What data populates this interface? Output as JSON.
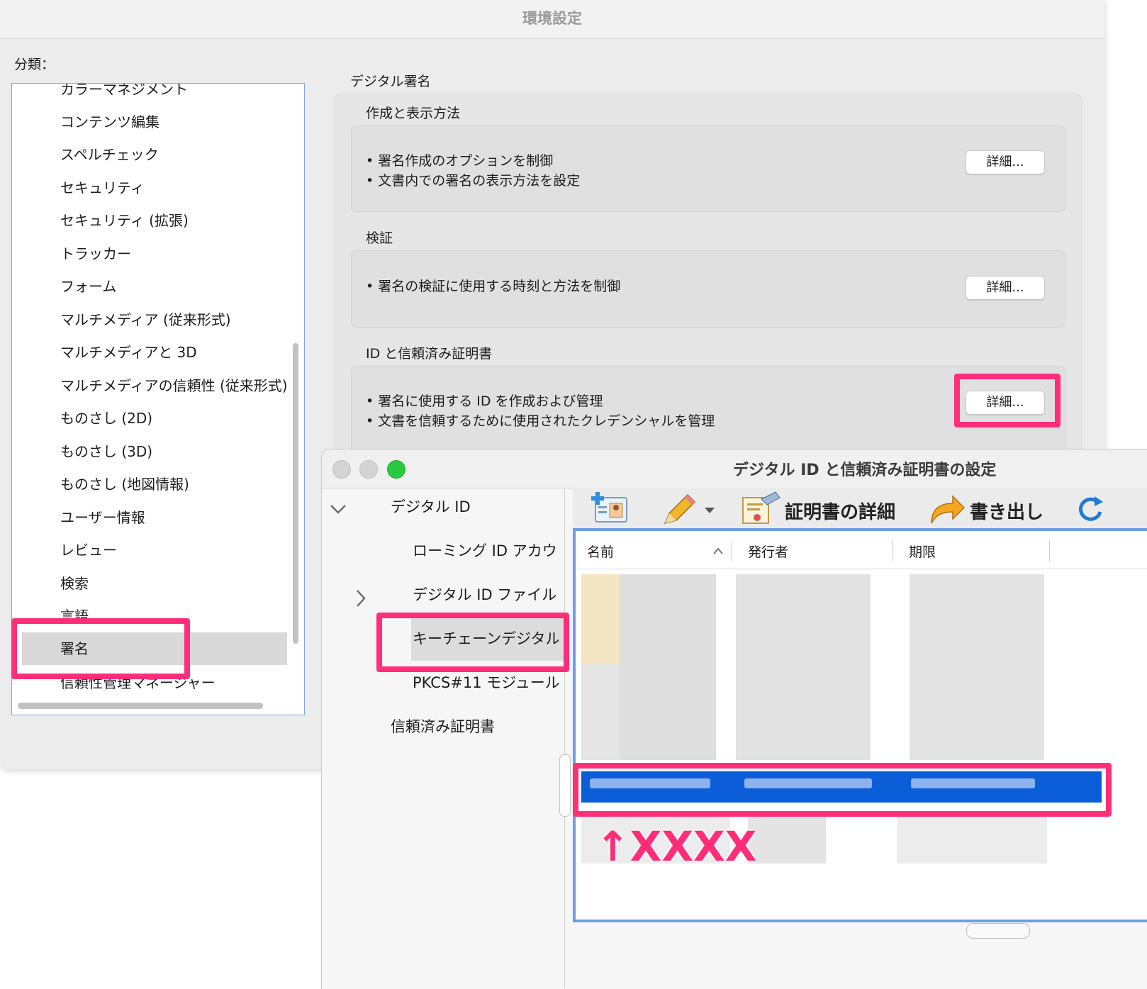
{
  "window": {
    "title": "環境設定"
  },
  "category_label": "分類：",
  "categories": [
    "カラーマネジメント",
    "コンテンツ編集",
    "スペルチェック",
    "セキュリティ",
    "セキュリティ (拡張)",
    "トラッカー",
    "フォーム",
    "マルチメディア (従来形式)",
    "マルチメディアと 3D",
    "マルチメディアの信頼性 (従来形式)",
    "ものさし (2D)",
    "ものさし (3D)",
    "ものさし (地図情報)",
    "ユーザー情報",
    "レビュー",
    "検索",
    "言語",
    "署名",
    "信頼性管理マネージャー"
  ],
  "selected_category": "署名",
  "signatures": {
    "heading": "デジタル署名",
    "sections": [
      {
        "title": "作成と表示方法",
        "bullets": [
          "• 署名作成のオプションを制御",
          "• 文書内での署名の表示方法を設定"
        ],
        "button": "詳細..."
      },
      {
        "title": "検証",
        "bullets": [
          "• 署名の検証に使用する時刻と方法を制御"
        ],
        "button": "詳細..."
      },
      {
        "title": "ID と信頼済み証明書",
        "bullets": [
          "• 署名に使用する ID を作成および管理",
          "• 文書を信頼するために使用されたクレデンシャルを管理"
        ],
        "button": "詳細..."
      }
    ]
  },
  "dialog": {
    "title": "デジタル ID と信頼済み証明書の設定",
    "tree": {
      "digital_id": "デジタル ID",
      "roaming": "ローミング ID アカウ",
      "id_file": "デジタル ID ファイル",
      "keychain": "キーチェーンデジタル",
      "pkcs": "PKCS#11 モジュール",
      "trusted": "信頼済み証明書"
    },
    "toolbar": {
      "cert_details": "証明書の詳細",
      "export": "書き出し"
    },
    "columns": [
      "名前",
      "発行者",
      "期限"
    ],
    "annotation": "↑XXXX"
  },
  "colors": {
    "callout": "#ff2e78",
    "selection": "#0b5ed8",
    "focus_ring": "#6e9de6"
  },
  "icons": [
    "add-id-icon",
    "pencil-icon",
    "dropdown-arrow-icon",
    "certificate-icon",
    "export-arrow-icon",
    "refresh-icon",
    "chevron-down-icon",
    "chevron-right-icon",
    "sort-ascending-icon"
  ]
}
